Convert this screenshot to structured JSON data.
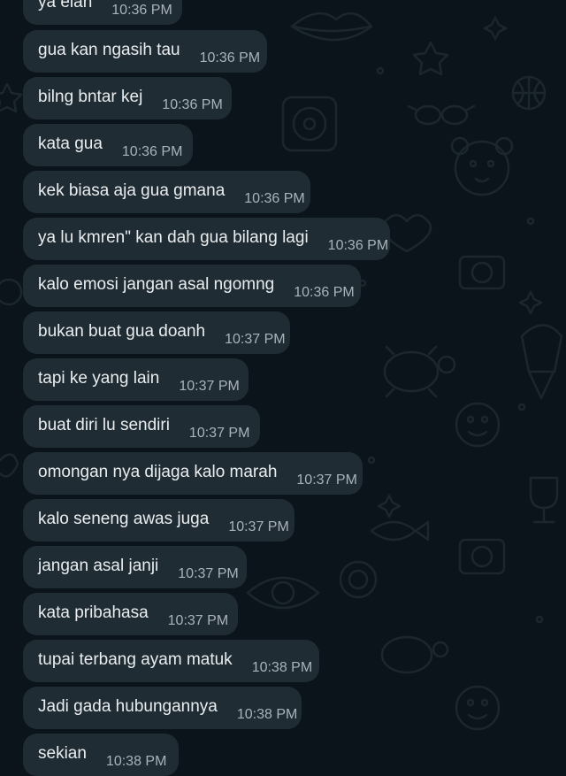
{
  "colors": {
    "background": "#0b141a",
    "bubble": "#202c33",
    "message_text": "#e9edef",
    "timestamp_text": "#a8b3ba",
    "wallpaper_doodles": "#1b272d"
  },
  "wallpaper": {
    "style": "doodle-pattern",
    "icons": [
      "lips-icon",
      "star-icon",
      "camera-icon",
      "bear-icon",
      "turtle-icon",
      "fish-icon",
      "smiley-icon",
      "sunglasses-icon",
      "basketball-icon",
      "heart-icon",
      "cupcake-icon",
      "trophy-icon"
    ]
  },
  "messages": [
    {
      "text": "ya elan",
      "time": "10:36 PM"
    },
    {
      "text": "gua kan ngasih tau",
      "time": "10:36 PM"
    },
    {
      "text": "bilng bntar kej",
      "time": "10:36 PM"
    },
    {
      "text": "kata gua",
      "time": "10:36 PM"
    },
    {
      "text": "kek biasa aja gua gmana",
      "time": "10:36 PM"
    },
    {
      "text": "ya lu kmren\" kan dah gua bilang lagi",
      "time": "10:36 PM"
    },
    {
      "text": "kalo emosi jangan asal ngomng",
      "time": "10:36 PM"
    },
    {
      "text": "bukan buat gua doanh",
      "time": "10:37 PM"
    },
    {
      "text": "tapi ke yang lain",
      "time": "10:37 PM"
    },
    {
      "text": "buat diri lu sendiri",
      "time": "10:37 PM"
    },
    {
      "text": "omongan nya dijaga kalo marah",
      "time": "10:37 PM"
    },
    {
      "text": "kalo seneng awas juga",
      "time": "10:37 PM"
    },
    {
      "text": "jangan asal janji",
      "time": "10:37 PM"
    },
    {
      "text": "kata pribahasa",
      "time": "10:37 PM"
    },
    {
      "text": "tupai terbang ayam matuk",
      "time": "10:38 PM"
    },
    {
      "text": "Jadi gada hubungannya",
      "time": "10:38 PM"
    },
    {
      "text": "sekian",
      "time": "10:38 PM"
    }
  ]
}
